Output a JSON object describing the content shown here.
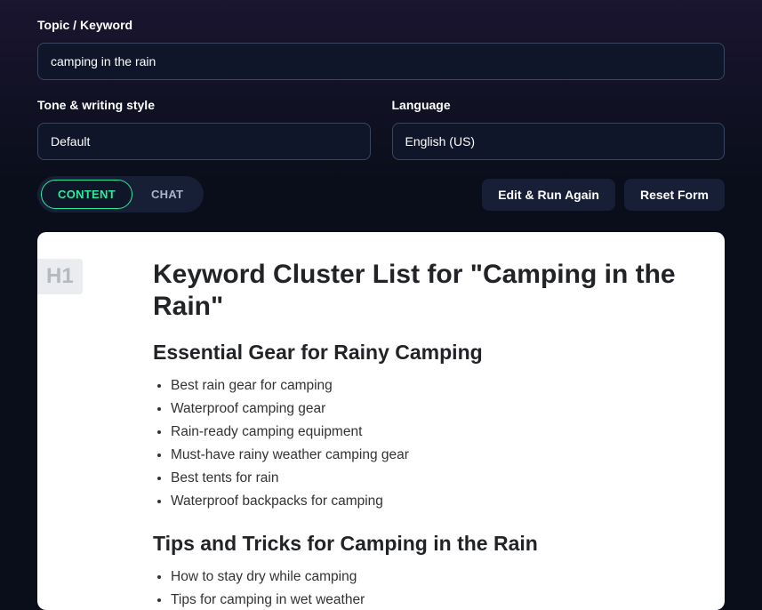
{
  "topic": {
    "label": "Topic / Keyword",
    "value": "camping in the rain"
  },
  "tone": {
    "label": "Tone & writing style",
    "value": "Default"
  },
  "language": {
    "label": "Language",
    "value": "English (US)"
  },
  "tabs": {
    "content": "CONTENT",
    "chat": "CHAT"
  },
  "buttons": {
    "edit_run": "Edit & Run Again",
    "reset": "Reset Form"
  },
  "badge": "H1",
  "output": {
    "title": "Keyword Cluster List for \"Camping in the Rain\"",
    "sections": [
      {
        "heading": "Essential Gear for Rainy Camping",
        "items": [
          "Best rain gear for camping",
          "Waterproof camping gear",
          "Rain-ready camping equipment",
          "Must-have rainy weather camping gear",
          "Best tents for rain",
          "Waterproof backpacks for camping"
        ]
      },
      {
        "heading": "Tips and Tricks for Camping in the Rain",
        "items": [
          "How to stay dry while camping",
          "Tips for camping in wet weather"
        ]
      }
    ]
  }
}
